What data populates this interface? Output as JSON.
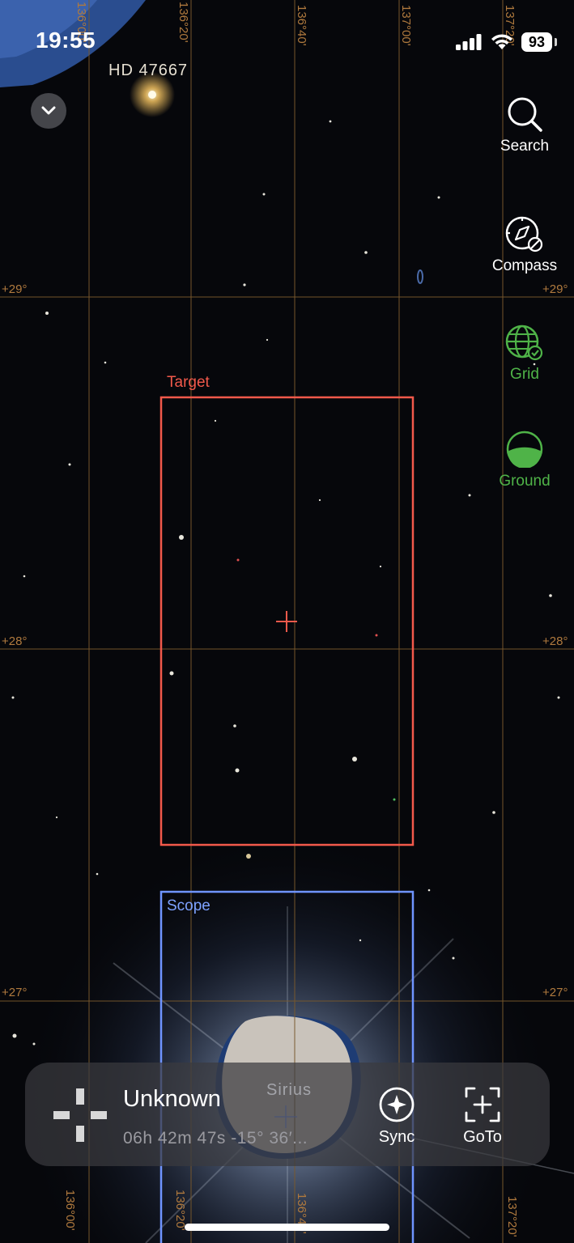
{
  "status_bar": {
    "time": "19:55",
    "battery": "93"
  },
  "sky": {
    "stars": {
      "hd": "HD 47667",
      "sirius": "Sirius"
    },
    "dec_labels": [
      "+29°",
      "+28°",
      "+27°"
    ],
    "ra_labels": [
      "136°00'",
      "136°20'",
      "136°40'",
      "137°00'",
      "137°20'"
    ]
  },
  "frames": {
    "target": "Target",
    "scope": "Scope"
  },
  "toolbar": {
    "search": "Search",
    "compass": "Compass",
    "grid": "Grid",
    "ground": "Ground"
  },
  "object_panel": {
    "name": "Unknown",
    "coords": "06h 42m 47s  -15° 36′...",
    "sync": "Sync",
    "goto": "GoTo"
  },
  "colors": {
    "target": "#f2594b",
    "scope": "#7ea2ff",
    "grid_lines": "#7a5a2e",
    "active_tool": "#4fb348"
  }
}
